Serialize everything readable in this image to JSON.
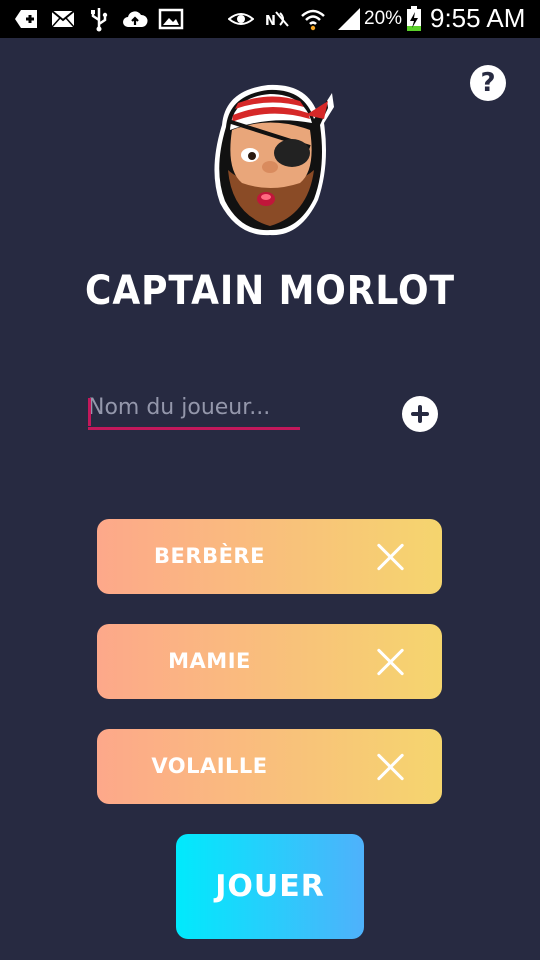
{
  "status_bar": {
    "battery_percent": "20%",
    "time": "9:55 AM",
    "icons": [
      "add-icon",
      "mail-icon",
      "usb-icon",
      "cloud-upload-icon",
      "image-icon",
      "eye-icon",
      "nfc-icon",
      "wifi-icon",
      "signal-icon",
      "battery-charging-icon"
    ]
  },
  "help": {
    "label": "?"
  },
  "app": {
    "title": "CAPTAIN MORLOT"
  },
  "player_input": {
    "placeholder": "Nom du joueur..."
  },
  "players": [
    {
      "name": "BERBÈRE"
    },
    {
      "name": "MAMIE"
    },
    {
      "name": "VOLAILLE"
    }
  ],
  "play_button": {
    "label": "JOUER"
  },
  "colors": {
    "background": "#272a41",
    "accent": "#c2185b",
    "card_gradient_start": "#fda88a",
    "card_gradient_end": "#f5d56e",
    "play_gradient_start": "#00eafc",
    "play_gradient_end": "#4fb1fb"
  }
}
